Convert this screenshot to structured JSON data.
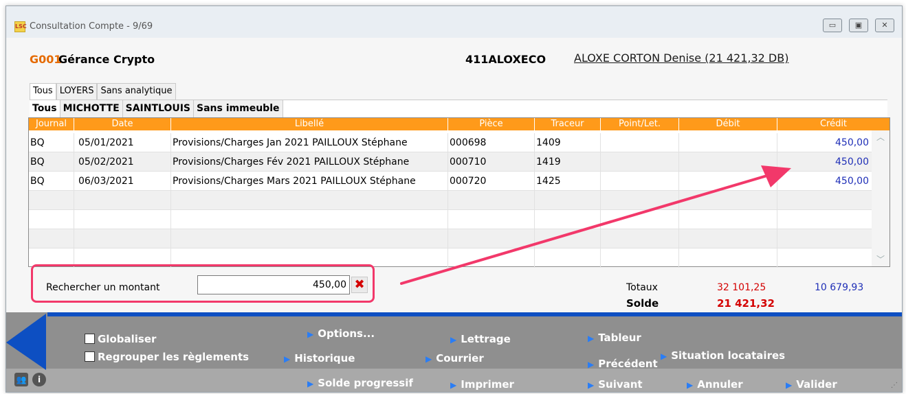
{
  "window": {
    "logo": "LSC",
    "title": "Consultation Compte - 9/69",
    "buttons": {
      "minimize": "▭",
      "maximize": "▣",
      "close": "✕"
    }
  },
  "header": {
    "code": "G001",
    "name": "Gérance Crypto",
    "account": "411ALOXECO",
    "tenant": "ALOXE CORTON Denise (21 421,32 DB)"
  },
  "tabs_level1": [
    {
      "label": "Tous"
    },
    {
      "label": "LOYERS"
    },
    {
      "label": "Sans analytique"
    }
  ],
  "tabs_level2": [
    {
      "label": "Tous"
    },
    {
      "label": "MICHOTTE"
    },
    {
      "label": "SAINTLOUIS"
    },
    {
      "label": "Sans immeuble"
    }
  ],
  "grid": {
    "columns": [
      "Journal",
      "Date",
      "Libellé",
      "Pièce",
      "Traceur",
      "Point/Let.",
      "Débit",
      "Crédit"
    ],
    "rows": [
      {
        "journal": "BQ",
        "date": "05/01/2021",
        "libelle": "Provisions/Charges Jan 2021  PAILLOUX Stéphane",
        "piece": "000698",
        "traceur": "1409",
        "point": "",
        "debit": "",
        "credit": "450,00"
      },
      {
        "journal": "BQ",
        "date": "05/02/2021",
        "libelle": "Provisions/Charges Fév 2021  PAILLOUX Stéphane",
        "piece": "000710",
        "traceur": "1419",
        "point": "",
        "debit": "",
        "credit": "450,00"
      },
      {
        "journal": "BQ",
        "date": "06/03/2021",
        "libelle": "Provisions/Charges Mars 2021  PAILLOUX Stéphane",
        "piece": "000720",
        "traceur": "1425",
        "point": "",
        "debit": "",
        "credit": "450,00"
      }
    ]
  },
  "search": {
    "label": "Rechercher un montant",
    "value": "450,00",
    "clear_icon": "✖"
  },
  "totals": {
    "label": "Totaux",
    "debit": "32 101,25",
    "credit": "10 679,93",
    "solde_label": "Solde",
    "solde_value": "21 421,32"
  },
  "toolbar": {
    "globaliser": "Globaliser",
    "regrouper": "Regrouper les règlements",
    "options": "Options...",
    "historique": "Historique",
    "solde_progressif": "Solde progressif",
    "lettrage": "Lettrage",
    "courrier": "Courrier",
    "imprimer": "Imprimer",
    "tableur": "Tableur",
    "precedent": "Précédent",
    "suivant": "Suivant",
    "situation": "Situation locataires",
    "annuler": "Annuler",
    "valider": "Valider"
  },
  "colors": {
    "accent_orange": "#ff9a1a",
    "code_orange": "#e56a00",
    "credit_blue": "#1f2fb7",
    "debit_red": "#d40000",
    "annotation_pink": "#f2386a",
    "toolbar_blue": "#0d4fc2"
  }
}
